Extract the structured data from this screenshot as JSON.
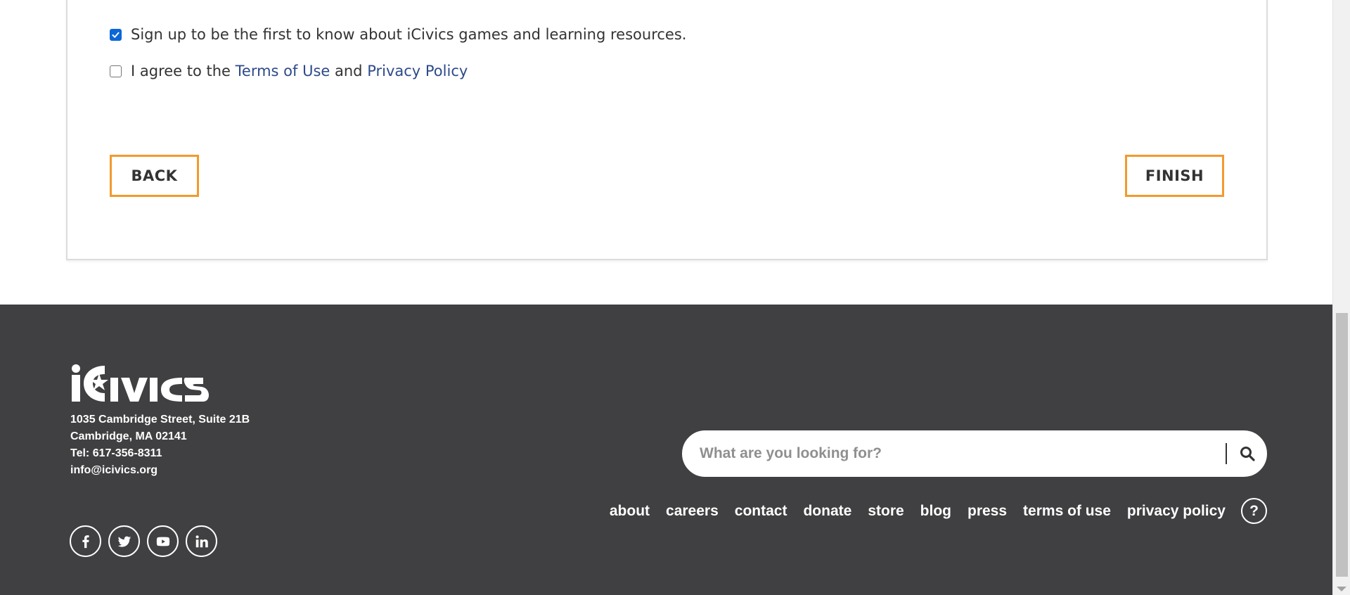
{
  "form": {
    "newsletter_label": "Sign up to be the first to know about iCivics games and learning resources.",
    "newsletter_checked": true,
    "terms_prefix": "I agree to the ",
    "terms_link": "Terms of Use",
    "terms_middle": " and ",
    "privacy_link": "Privacy Policy",
    "terms_checked": false,
    "back_label": "BACK",
    "finish_label": "FINISH",
    "accent_color": "#f29a2e",
    "link_color": "#2d4a8a"
  },
  "footer": {
    "logo_text": "iCivics",
    "address_line1": "1035 Cambridge Street, Suite 21B",
    "address_line2": "Cambridge, MA 02141",
    "phone": "Tel: 617-356-8311",
    "email": "info@icivics.org",
    "socials": [
      "facebook-icon",
      "twitter-icon",
      "youtube-icon",
      "linkedin-icon"
    ],
    "search_placeholder": "What are you looking for?",
    "nav": [
      "about",
      "careers",
      "contact",
      "donate",
      "store",
      "blog",
      "press",
      "terms of use",
      "privacy policy"
    ],
    "help_label": "?",
    "background_color": "#404042"
  }
}
